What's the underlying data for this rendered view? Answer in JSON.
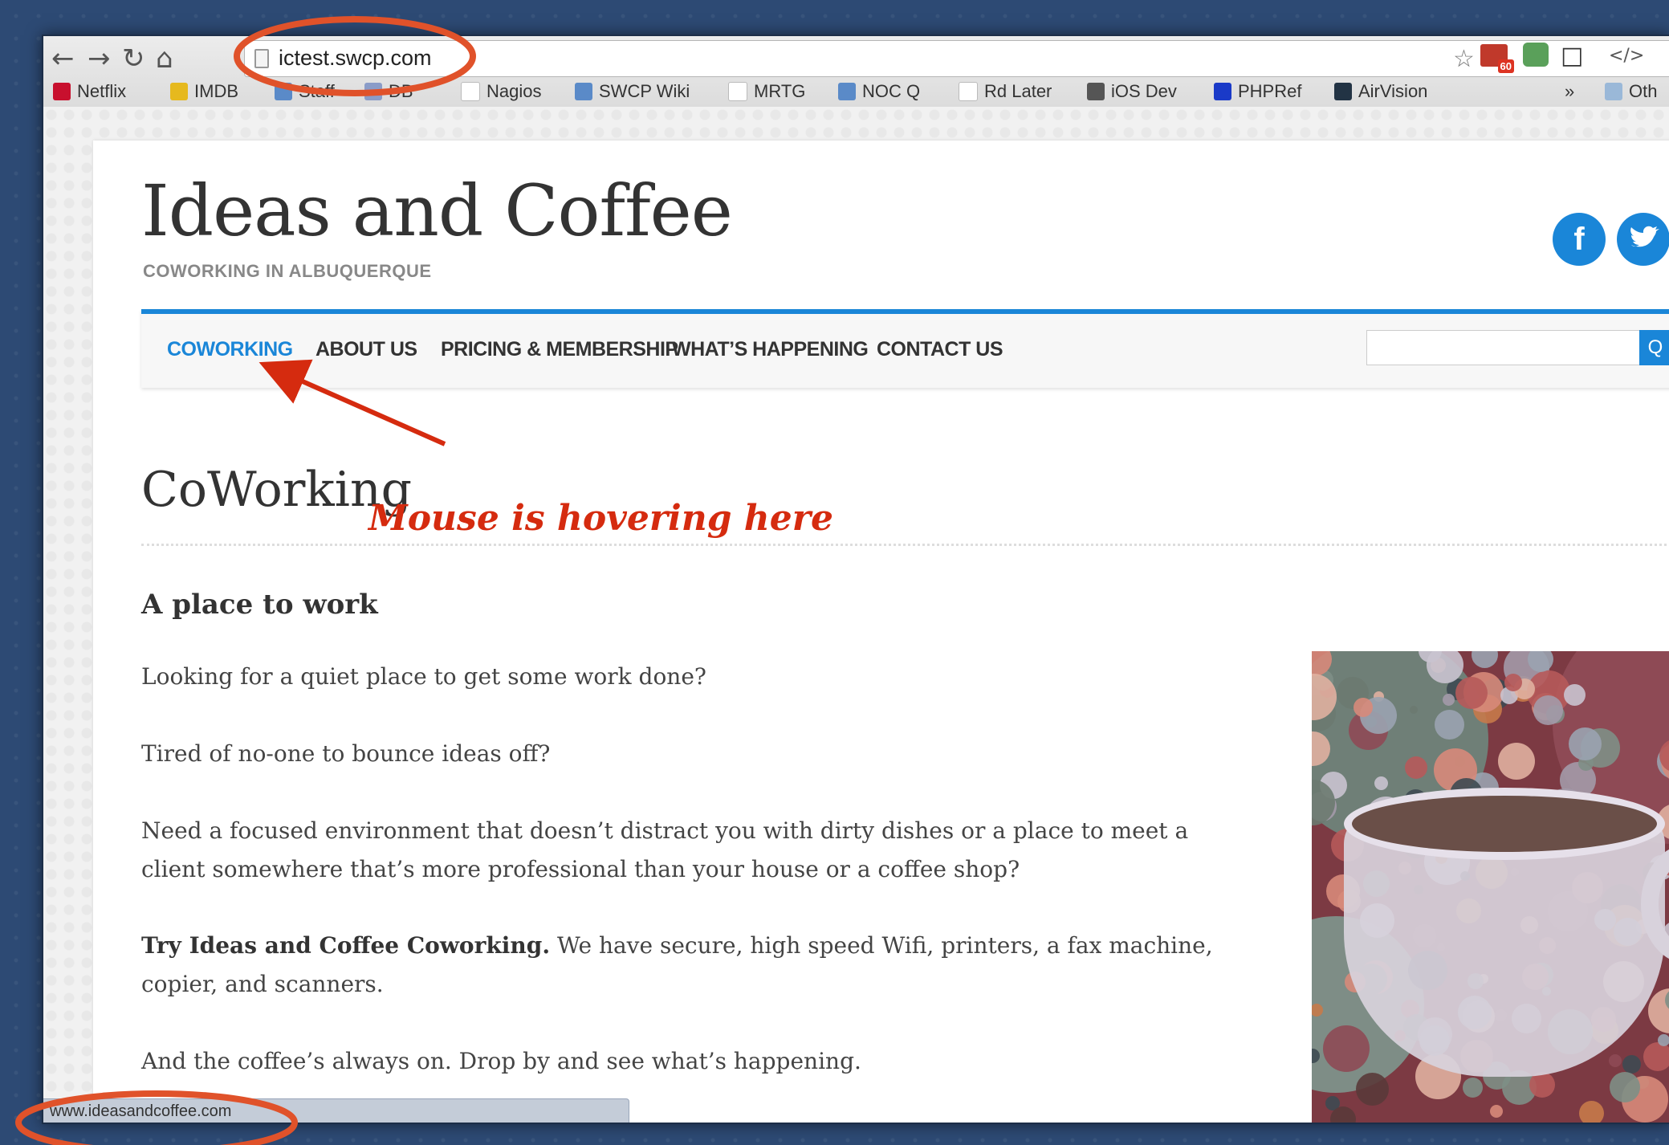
{
  "browser": {
    "url": "ictest.swcp.com",
    "status_url": "www.ideasandcoffee.com",
    "extension_badge": "60",
    "bookmarks": [
      {
        "label": "Netflix",
        "icon": "netflix-icon",
        "color": "#c8102e"
      },
      {
        "label": "IMDB",
        "icon": "imdb-icon",
        "color": "#e6b91e"
      },
      {
        "label": "Staff",
        "icon": "globe-icon",
        "color": "#5a8ac8"
      },
      {
        "label": "DB",
        "icon": "pma-icon",
        "color": "#8a9cc8"
      },
      {
        "label": "Nagios",
        "icon": "page-icon",
        "color": "#ffffff"
      },
      {
        "label": "SWCP Wiki",
        "icon": "globe-icon",
        "color": "#5a8ac8"
      },
      {
        "label": "MRTG",
        "icon": "page-icon",
        "color": "#ffffff"
      },
      {
        "label": "NOC Q",
        "icon": "globe-icon",
        "color": "#5a8ac8"
      },
      {
        "label": "Rd Later",
        "icon": "page-icon",
        "color": "#ffffff"
      },
      {
        "label": "iOS Dev",
        "icon": "apple-icon",
        "color": "#555555"
      },
      {
        "label": "PHPRef",
        "icon": "h-icon",
        "color": "#1a3ac8"
      },
      {
        "label": "AirVision",
        "icon": "airvision-icon",
        "color": "#223344"
      },
      {
        "label": "Oth",
        "icon": "folder-icon",
        "color": "#9ab8d8"
      }
    ],
    "overflow_label": "»"
  },
  "site": {
    "title": "Ideas and Coffee",
    "tagline": "COWORKING IN ALBUQUERQUE",
    "social": [
      {
        "name": "facebook",
        "glyph": "f"
      },
      {
        "name": "twitter",
        "glyph": "t"
      }
    ],
    "nav": [
      {
        "label": "COWORKING",
        "active": true
      },
      {
        "label": "ABOUT US",
        "active": false
      },
      {
        "label": "PRICING & MEMBERSHIP",
        "active": false
      },
      {
        "label": "WHAT’S HAPPENING",
        "active": false
      },
      {
        "label": "CONTACT US",
        "active": false
      }
    ],
    "search_button_glyph": "Q"
  },
  "annotation": {
    "text": "Mouse is hovering here",
    "color": "#d52b0f"
  },
  "content": {
    "heading": "CoWorking",
    "section_heading": "A place to work",
    "p1": "Looking for a quiet place to get some work done?",
    "p2": "Tired of no-one to bounce ideas off?",
    "p3": "Need a focused environment that doesn’t distract you with dirty dishes or a place to meet a client somewhere that’s more professional than your house or a coffee shop?",
    "p4_bold": "Try Ideas and Coffee Coworking.",
    "p4_rest": " We have secure, high speed Wifi, printers, a fax machine, copier, and scanners.",
    "p5": "And the coffee’s always on. Drop by and see what’s happening."
  },
  "colors": {
    "accent": "#1a86d8",
    "annotation": "#d52b0f",
    "highlight_ellipse": "#e0522a"
  }
}
